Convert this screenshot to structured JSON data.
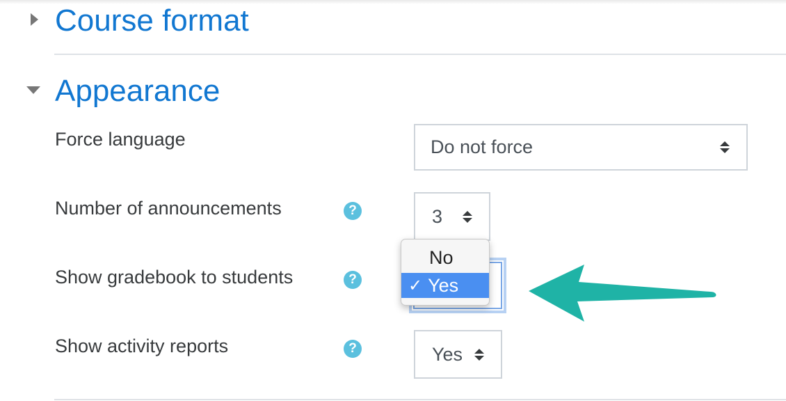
{
  "sections": {
    "course_format": {
      "title": "Course format"
    },
    "appearance": {
      "title": "Appearance"
    }
  },
  "fields": {
    "force_language": {
      "label": "Force language",
      "value": "Do not force"
    },
    "announcements": {
      "label": "Number of announcements",
      "value": "3",
      "help": "?"
    },
    "gradebook": {
      "label": "Show gradebook to students",
      "help": "?",
      "options": [
        "No",
        "Yes"
      ],
      "selected": "Yes",
      "check": "✓"
    },
    "activity_reports": {
      "label": "Show activity reports",
      "value": "Yes",
      "help": "?"
    }
  },
  "colors": {
    "link": "#1177d1",
    "help": "#5bc0de",
    "selected_option": "#4a8ff1",
    "annotation_arrow": "#1fb3a6"
  }
}
